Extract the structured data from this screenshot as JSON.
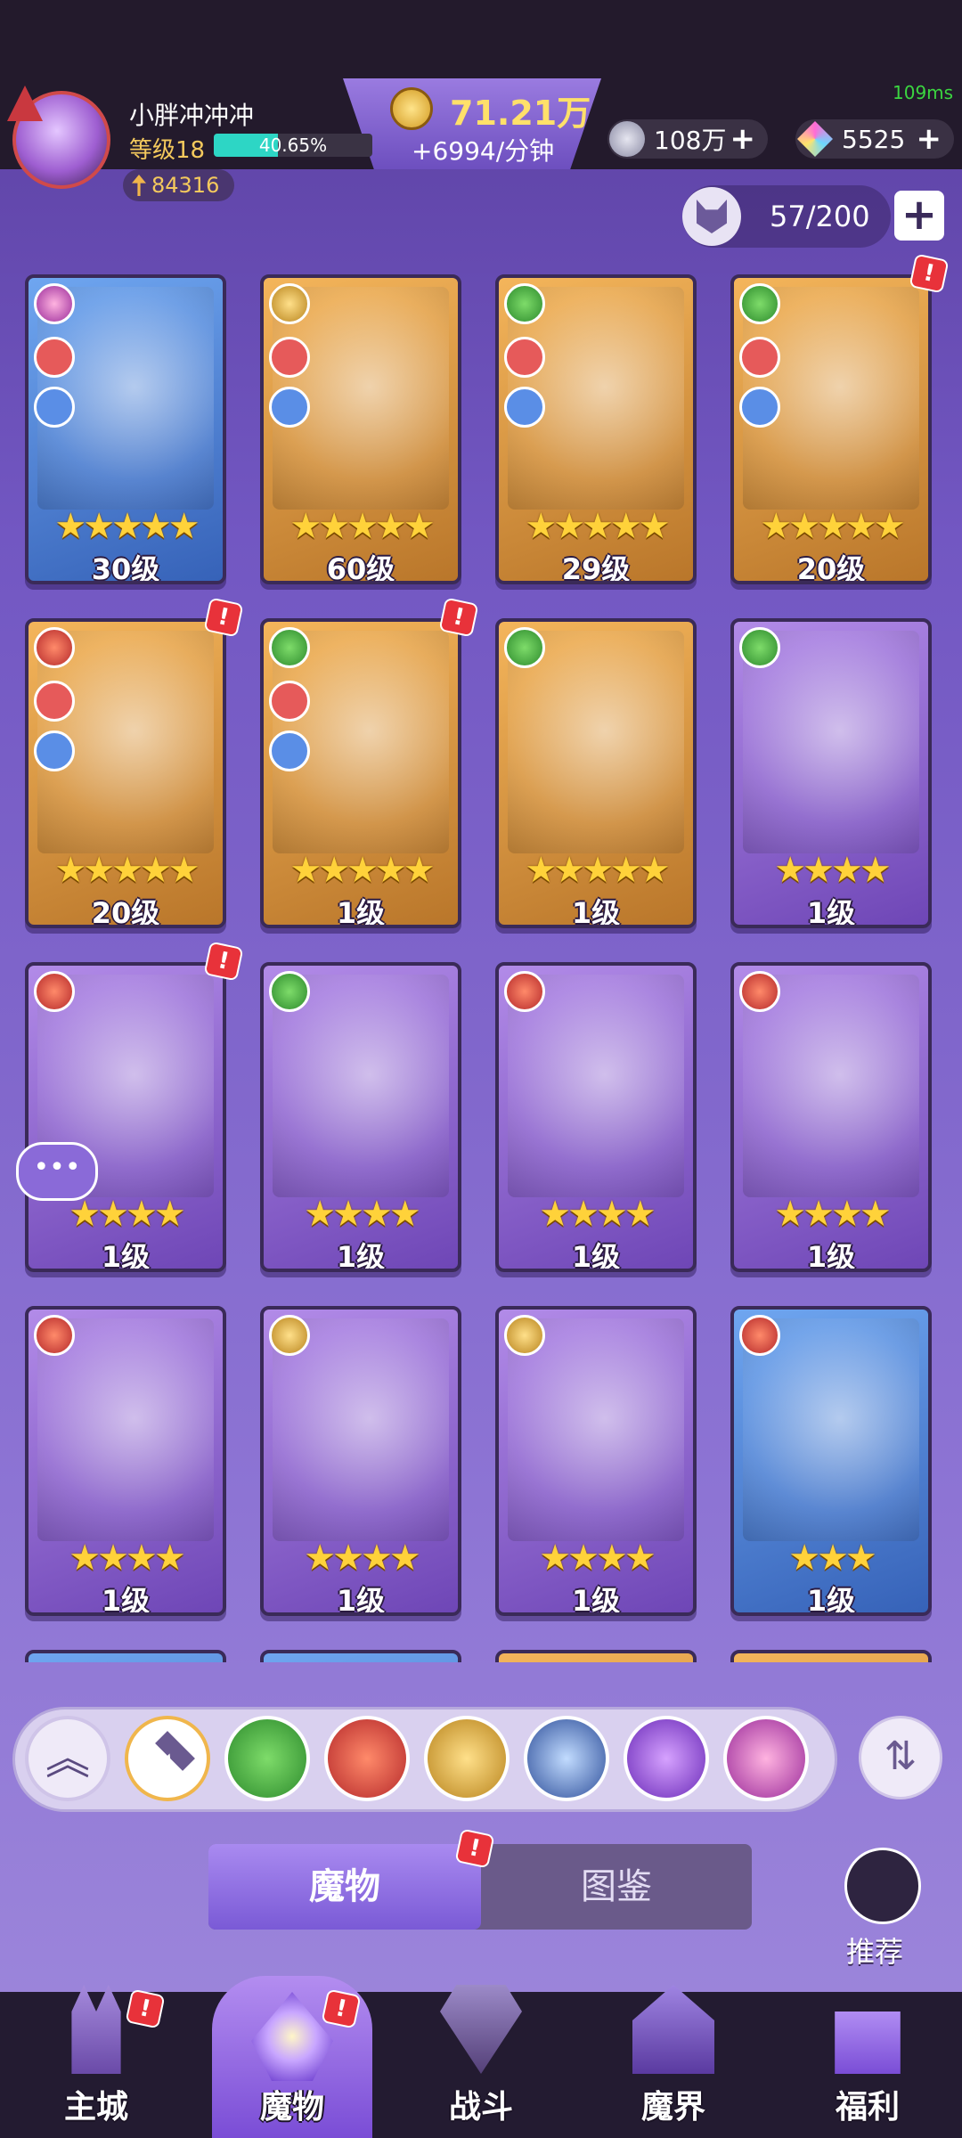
{
  "top": {
    "player_name": "小胖冲冲冲",
    "player_level": "等级18",
    "xp_fraction": 0.4065,
    "xp_text": "40.65%",
    "power": "84316",
    "gold_amount": "71.21万",
    "gold_rate": "+6994/分钟",
    "gem_amount": "108万",
    "crystal_amount": "5525",
    "fps": "109ms"
  },
  "capacity": {
    "text": "57/200"
  },
  "cards": [
    {
      "element": "rune",
      "frame": "blue",
      "stars": 5,
      "level": "30级",
      "weapon": true,
      "armor": true
    },
    {
      "element": "time",
      "frame": "gold",
      "stars": 5,
      "level": "60级",
      "weapon": true,
      "armor": true
    },
    {
      "element": "forest",
      "frame": "gold",
      "stars": 5,
      "level": "29级",
      "weapon": true,
      "armor": true
    },
    {
      "element": "forest",
      "frame": "gold",
      "stars": 5,
      "level": "20级",
      "weapon": true,
      "armor": true,
      "alert": true
    },
    {
      "element": "fire",
      "frame": "gold",
      "stars": 5,
      "level": "20级",
      "weapon": true,
      "armor": true,
      "alert": true
    },
    {
      "element": "forest",
      "frame": "gold",
      "stars": 5,
      "level": "1级",
      "weapon": true,
      "armor": true,
      "alert": true
    },
    {
      "element": "forest",
      "frame": "gold",
      "stars": 5,
      "level": "1级"
    },
    {
      "element": "forest",
      "frame": "purple",
      "stars": 4,
      "level": "1级"
    },
    {
      "element": "fire",
      "frame": "purple",
      "stars": 4,
      "level": "1级",
      "alert": true
    },
    {
      "element": "forest",
      "frame": "purple",
      "stars": 4,
      "level": "1级"
    },
    {
      "element": "fire",
      "frame": "purple",
      "stars": 4,
      "level": "1级"
    },
    {
      "element": "fire",
      "frame": "purple",
      "stars": 4,
      "level": "1级"
    },
    {
      "element": "fire",
      "frame": "purple",
      "stars": 4,
      "level": "1级"
    },
    {
      "element": "time",
      "frame": "purple",
      "stars": 4,
      "level": "1级"
    },
    {
      "element": "time",
      "frame": "purple",
      "stars": 4,
      "level": "1级"
    },
    {
      "element": "fire",
      "frame": "blue",
      "stars": 3,
      "level": "1级"
    }
  ],
  "filters": [
    "all",
    "forest",
    "fire",
    "time",
    "dragon",
    "eye",
    "rune"
  ],
  "tabs": {
    "monster": "魔物",
    "codex": "图鉴"
  },
  "recommend_label": "推荐",
  "nav": [
    {
      "label": "主城",
      "icon": "castle",
      "alert": true
    },
    {
      "label": "魔物",
      "icon": "monster",
      "alert": true,
      "active": true
    },
    {
      "label": "战斗",
      "icon": "battle"
    },
    {
      "label": "魔界",
      "icon": "realm"
    },
    {
      "label": "福利",
      "icon": "welfare"
    }
  ],
  "colors": {
    "gold_text": "#ffe06a",
    "star": "#ffd23a",
    "alert_red": "#e8323a",
    "xp_fill": "#2dd6c5"
  }
}
